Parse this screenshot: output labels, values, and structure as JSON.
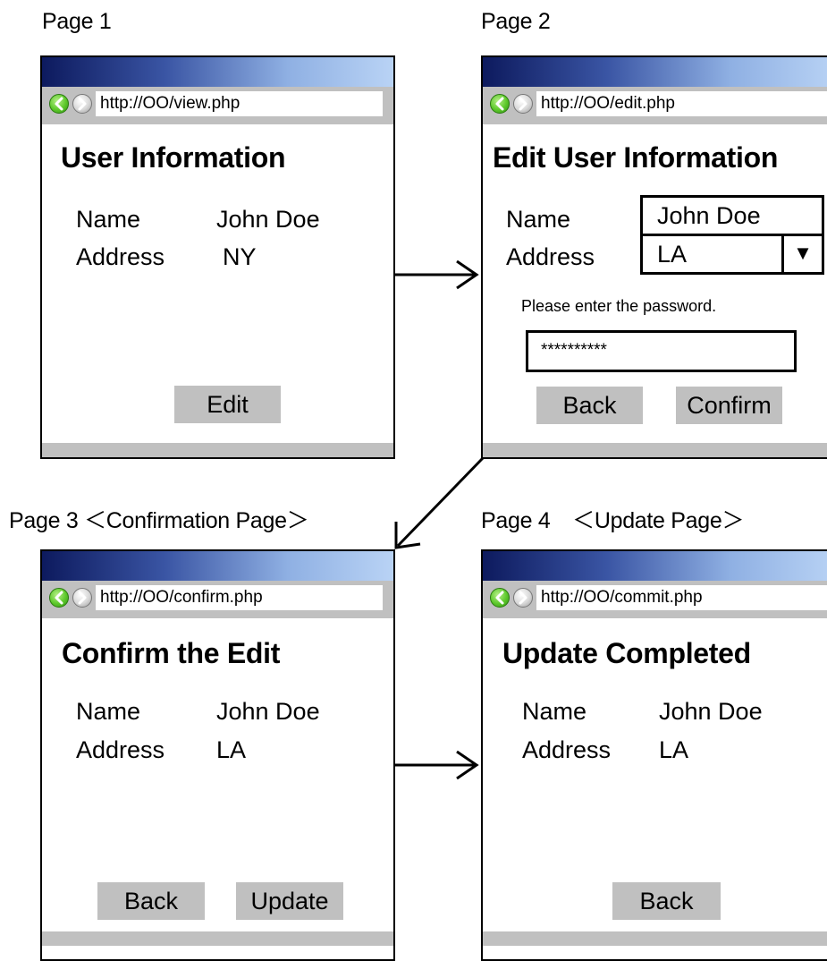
{
  "captions": {
    "page1": "Page 1",
    "page2": "Page 2",
    "page3": "Page 3 ＜Confirmation Page＞",
    "page4": "Page 4　＜Update Page＞"
  },
  "labels": {
    "name": "Name",
    "address": "Address"
  },
  "page1": {
    "url": "http://OO/view.php",
    "title": "User Information",
    "name_value": "John Doe",
    "address_value": "NY",
    "edit_button": "Edit"
  },
  "page2": {
    "url": "http://OO/edit.php",
    "title": "Edit User Information",
    "name_value": "John Doe",
    "address_value": "LA",
    "password_prompt": "Please enter the password.",
    "password_value": "**********",
    "back_button": "Back",
    "confirm_button": "Confirm"
  },
  "page3": {
    "url": "http://OO/confirm.php",
    "title": "Confirm the Edit",
    "name_value": "John Doe",
    "address_value": "LA",
    "back_button": "Back",
    "update_button": "Update"
  },
  "page4": {
    "url": "http://OO/commit.php",
    "title": "Update Completed",
    "name_value": "John Doe",
    "address_value": "LA",
    "back_button": "Back"
  },
  "icons": {
    "back": "back-arrow-icon",
    "forward": "forward-arrow-icon",
    "dropdown": "dropdown-triangle-icon"
  },
  "colors": {
    "titlebar_start": "#0d1a5e",
    "titlebar_end": "#b9d3f5",
    "chrome_gray": "#c0c0c0",
    "back_icon_green": "#5cc82a"
  }
}
